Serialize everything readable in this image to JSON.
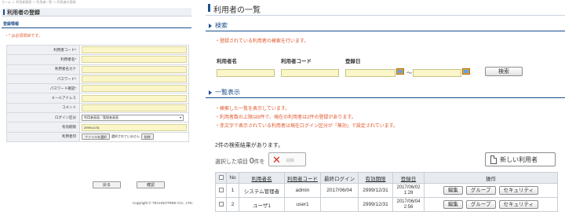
{
  "left": {
    "breadcrumb": "ホーム ＞ 利用者管理 ＞ 利用者一覧 ＞ 利用者の登録",
    "title": "利用者の登録",
    "section": "登録情報",
    "required_note": "・* は必須項目です。",
    "form": {
      "labels": [
        "利用者コード*",
        "利用者名*",
        "利用者名カナ",
        "パスワード*",
        "パスワード確認*",
        "メールアドレス",
        "コメント",
        "ログイン区分",
        "有効期限",
        "利用者印"
      ],
      "login_type_value": "利用者画面／管理者画面",
      "expiry_value": "2999/12/31",
      "file_button": "ファイルを選択",
      "file_status": "選択されていません",
      "delete_button": "削除"
    },
    "actions": {
      "back": "戻る",
      "confirm": "確認"
    },
    "copyright": "Copyright © TECHNOTREE CO., LTD."
  },
  "right": {
    "title": "利用者の一覧",
    "search": {
      "heading": "検索",
      "note": "・登録されている利用者の検索を行います。",
      "user_name_label": "利用者名",
      "user_code_label": "利用者コード",
      "date_label": "登録日",
      "tilde": "～",
      "search_button": "検索"
    },
    "list": {
      "heading": "一覧表示",
      "notes": [
        "・検索した一覧を表示しています。",
        "・利用者数の上限は8件で、現在の利用者は2件の登録があります。",
        "・赤文字で表示されている利用者は現在ログイン区分が「無効」で設定されています。"
      ],
      "result_text": "2件の検索結果があります。",
      "selected_prefix": "選択した項目",
      "selected_count": "0",
      "selected_suffix": "件を",
      "delete_label": "削除",
      "new_user_button": "新しい利用者",
      "columns": [
        "No",
        "利用者名",
        "利用者コード",
        "最終ログイン",
        "有効期限",
        "登録日",
        "操作"
      ],
      "rows": [
        {
          "no": "1",
          "name": "システム管理者",
          "code": "admin",
          "last_login": "2017/06/04",
          "expiry": "2999/12/31",
          "registered": "2017/06/02 1:28"
        },
        {
          "no": "2",
          "name": "ユーザ1",
          "code": "user1",
          "last_login": "",
          "expiry": "2999/12/31",
          "registered": "2017/06/04 2:56"
        }
      ],
      "row_actions": [
        "編集",
        "グループ",
        "セキュリティ"
      ]
    }
  }
}
